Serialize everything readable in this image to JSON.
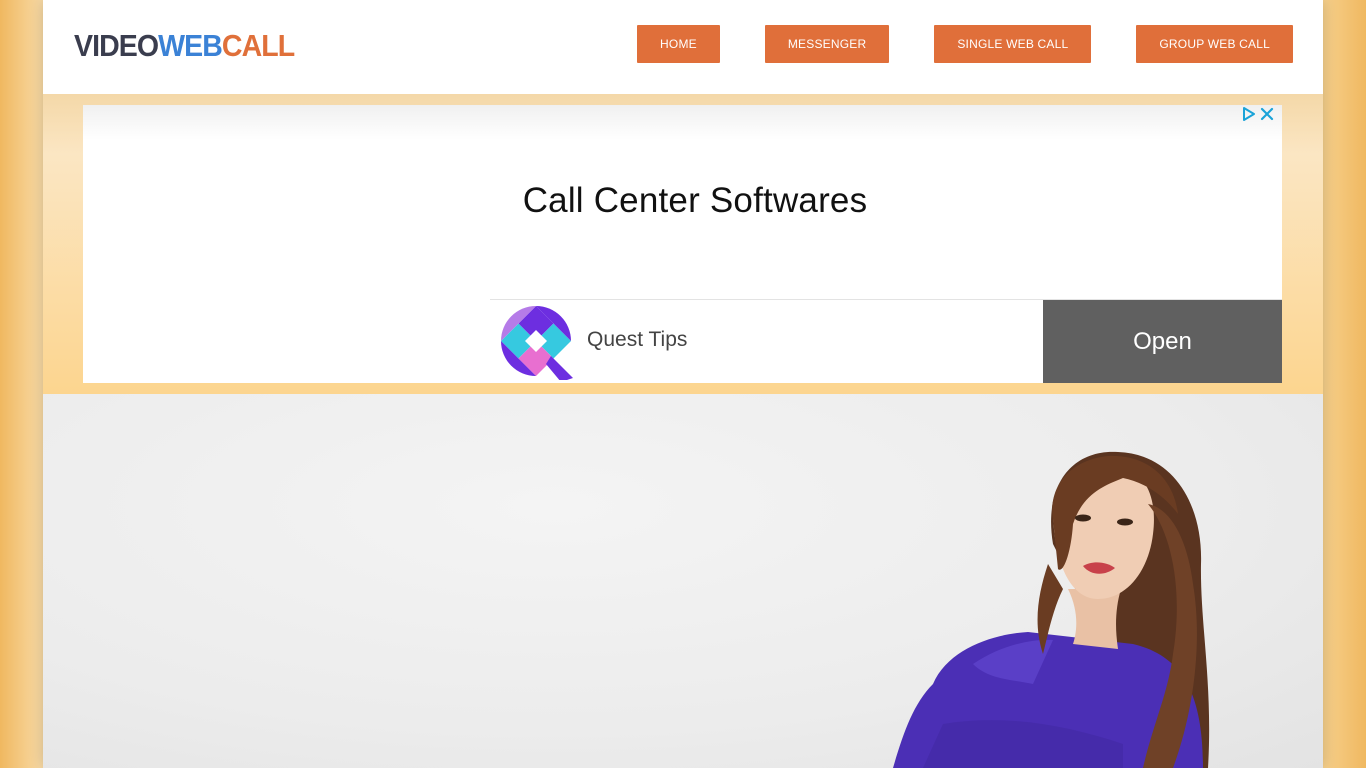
{
  "logo": {
    "part1": "VIDEO",
    "part2": "WEB",
    "part3": "CALL"
  },
  "nav": {
    "items": [
      {
        "label": "HOME"
      },
      {
        "label": "MESSENGER"
      },
      {
        "label": "SINGLE WEB CALL"
      },
      {
        "label": "GROUP WEB CALL"
      }
    ]
  },
  "ad": {
    "choices_icon": "play-triangle-icon",
    "close_icon": "close-icon",
    "headline": "Call Center Softwares",
    "brand": "Quest Tips",
    "brand_icon": "quest-tips-logo",
    "cta": "Open"
  },
  "hero": {
    "image": "woman-in-purple-top-photo"
  },
  "colors": {
    "accent": "#e06f3a",
    "logo_dark": "#3a3d4e",
    "logo_blue": "#3b82d6",
    "ad_button": "#606060"
  }
}
